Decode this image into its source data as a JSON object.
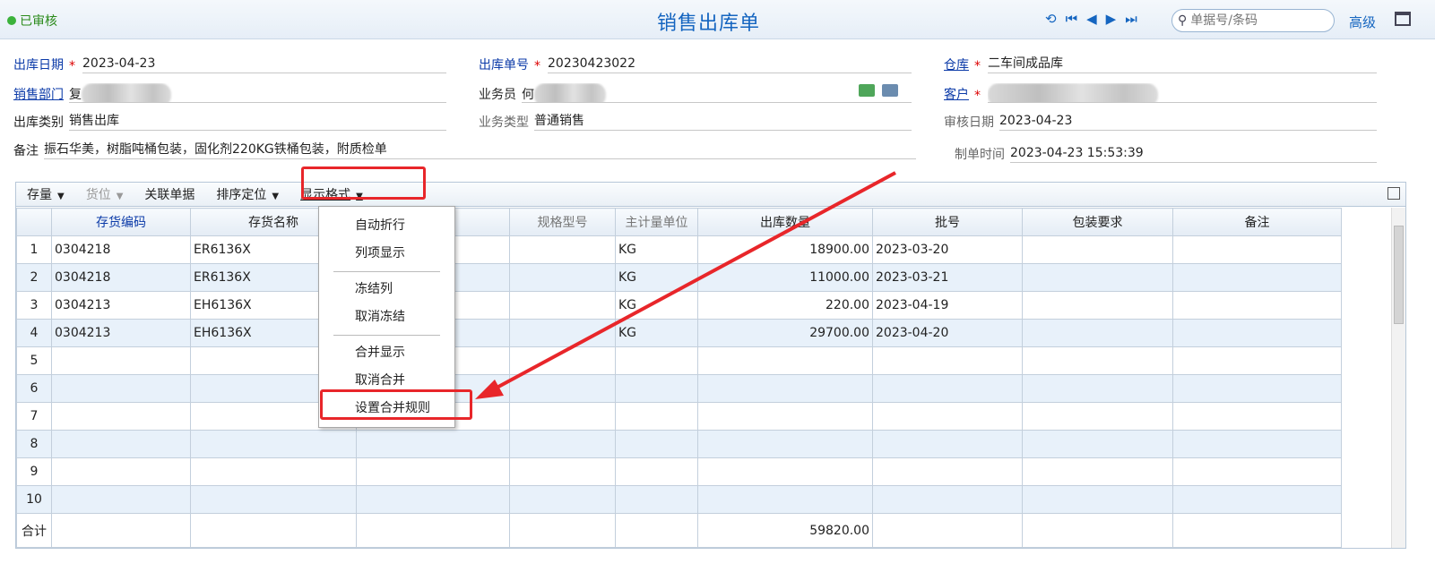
{
  "status": {
    "label": "已审核",
    "color": "#3bb23b"
  },
  "title": "销售出库单",
  "search": {
    "placeholder": "单据号/条码"
  },
  "advanced": "高级",
  "header": {
    "out_date": {
      "label": "出库日期",
      "required": "*",
      "value": "2023-04-23"
    },
    "out_no": {
      "label": "出库单号",
      "required": "*",
      "value": "20230423022"
    },
    "warehouse": {
      "label": "仓库",
      "required": "*",
      "value": "二车间成品库"
    },
    "sales_dept": {
      "label": "销售部门",
      "value": "复"
    },
    "salesman": {
      "label": "业务员",
      "value": "何"
    },
    "customer": {
      "label": "客户",
      "required": "*",
      "value": ""
    },
    "out_type": {
      "label": "出库类别",
      "value": "销售出库"
    },
    "biz_type": {
      "label": "业务类型",
      "value": "普通销售"
    },
    "audit_date": {
      "label": "审核日期",
      "value": "2023-04-23"
    },
    "remark": {
      "label": "备注",
      "value": "振石华美，树脂吨桶包装，固化剂220KG铁桶包装，附质检单"
    },
    "created_time": {
      "label": "制单时间",
      "value": "2023-04-23 15:53:39"
    }
  },
  "toolbar": {
    "stock": "存量",
    "location": "货位",
    "related": "关联单据",
    "sort": "排序定位",
    "display": "显示格式"
  },
  "columns": [
    "",
    "存货编码",
    "存货名称",
    "名称",
    "规格型号",
    "主计量单位",
    "出库数量",
    "批号",
    "包装要求",
    "备注"
  ],
  "rows": [
    {
      "idx": "1",
      "code": "0304218",
      "name": "ER6136X",
      "unit": "KG",
      "qty": "18900.00",
      "batch": "2023-03-20"
    },
    {
      "idx": "2",
      "code": "0304218",
      "name": "ER6136X",
      "unit": "KG",
      "qty": "11000.00",
      "batch": "2023-03-21"
    },
    {
      "idx": "3",
      "code": "0304213",
      "name": "EH6136X",
      "unit": "KG",
      "qty": "220.00",
      "batch": "2023-04-19"
    },
    {
      "idx": "4",
      "code": "0304213",
      "name": "EH6136X",
      "unit": "KG",
      "qty": "29700.00",
      "batch": "2023-04-20"
    },
    {
      "idx": "5",
      "code": "",
      "name": "",
      "unit": "",
      "qty": "",
      "batch": ""
    },
    {
      "idx": "6",
      "code": "",
      "name": "",
      "unit": "",
      "qty": "",
      "batch": ""
    },
    {
      "idx": "7",
      "code": "",
      "name": "",
      "unit": "",
      "qty": "",
      "batch": ""
    },
    {
      "idx": "8",
      "code": "",
      "name": "",
      "unit": "",
      "qty": "",
      "batch": ""
    },
    {
      "idx": "9",
      "code": "",
      "name": "",
      "unit": "",
      "qty": "",
      "batch": ""
    },
    {
      "idx": "10",
      "code": "",
      "name": "",
      "unit": "",
      "qty": "",
      "batch": ""
    }
  ],
  "total": {
    "label": "合计",
    "qty": "59820.00"
  },
  "menu": {
    "auto_wrap": "自动折行",
    "column_show": "列项显示",
    "freeze": "冻结列",
    "unfreeze": "取消冻结",
    "merge_show": "合并显示",
    "unmerge": "取消合并",
    "merge_rule": "设置合并规则"
  },
  "highlight_color": "#e8262a"
}
